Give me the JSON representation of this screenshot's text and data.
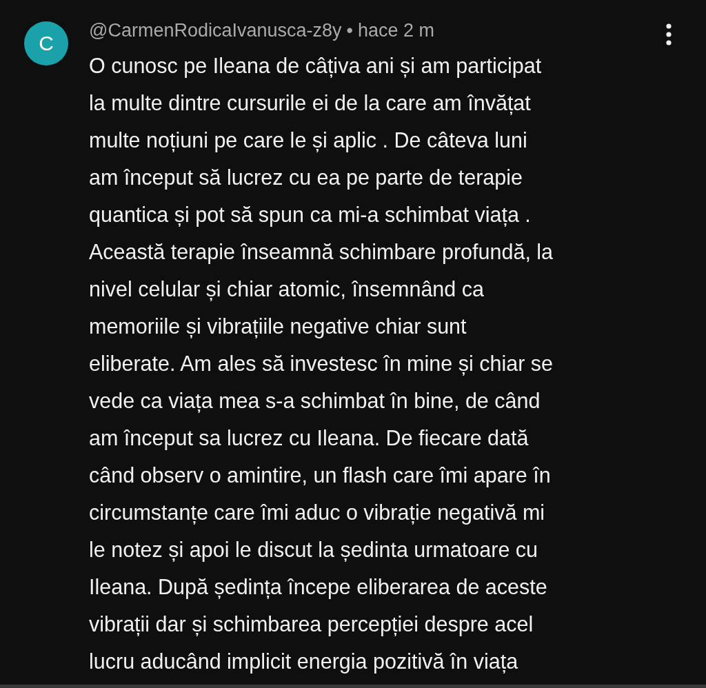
{
  "comment": {
    "avatar": {
      "letter": "C",
      "color": "#1ba1a9"
    },
    "author": "@CarmenRodicaIvanusca-z8y",
    "separator": "•",
    "time": "hace 2 m",
    "lines": [
      "O cunosc pe Ileana de câțiva ani și am participat",
      "la multe dintre cursurile ei de la care am învățat",
      "multe noțiuni pe care le și aplic . De câteva luni",
      "am început să lucrez cu ea pe parte de terapie",
      "quantica și pot să spun ca mi-a schimbat viața .",
      "Această terapie înseamnă schimbare profundă, la",
      "nivel celular și chiar atomic, însemnând ca",
      "memoriile și vibrațiile negative chiar sunt",
      "eliberate. Am ales să investesc în mine și chiar se",
      "vede ca viața mea s-a schimbat în bine, de când",
      "am început sa lucrez cu Ileana. De fiecare dată",
      "când observ o amintire, un flash care îmi apare în",
      "circumstanțe care îmi aduc o vibrație negativă mi",
      "le notez și apoi le discut la ședinta urmatoare cu",
      "Ileana. După ședința începe eliberarea de aceste",
      "vibrații  dar și schimbarea percepției despre acel",
      "lucru aducând implicit energia pozitivă în viața"
    ]
  }
}
